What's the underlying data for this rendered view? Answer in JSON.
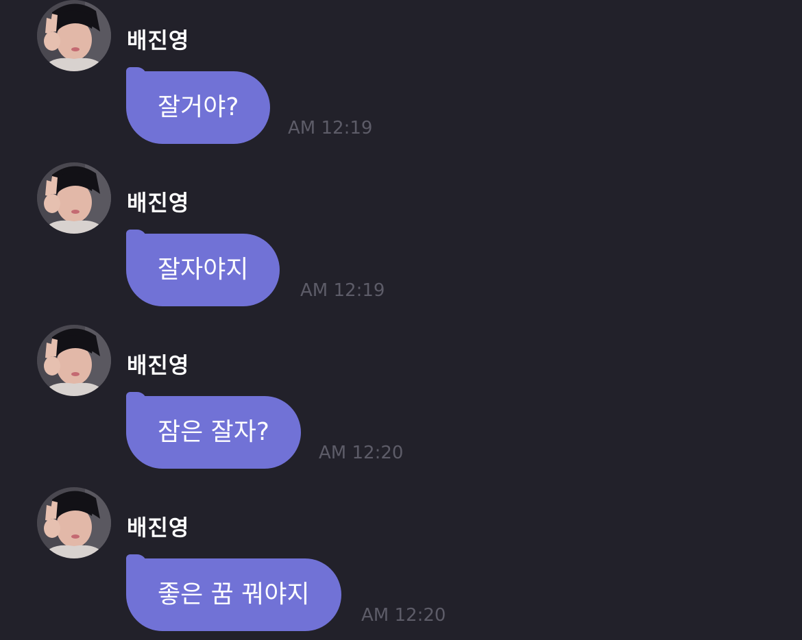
{
  "messages": [
    {
      "sender": "배진영",
      "text": "잘거야?",
      "time": "AM 12:19"
    },
    {
      "sender": "배진영",
      "text": "잘자야지",
      "time": "AM 12:19"
    },
    {
      "sender": "배진영",
      "text": "잠은 잘자?",
      "time": "AM 12:20"
    },
    {
      "sender": "배진영",
      "text": "좋은 꿈 꿔야지",
      "time": "AM 12:20"
    }
  ],
  "icons": {
    "avatar": "profile-photo"
  },
  "colors": {
    "background": "#22212a",
    "bubble": "#7172d6",
    "text": "#ffffff",
    "timestamp": "#5d5c68"
  }
}
